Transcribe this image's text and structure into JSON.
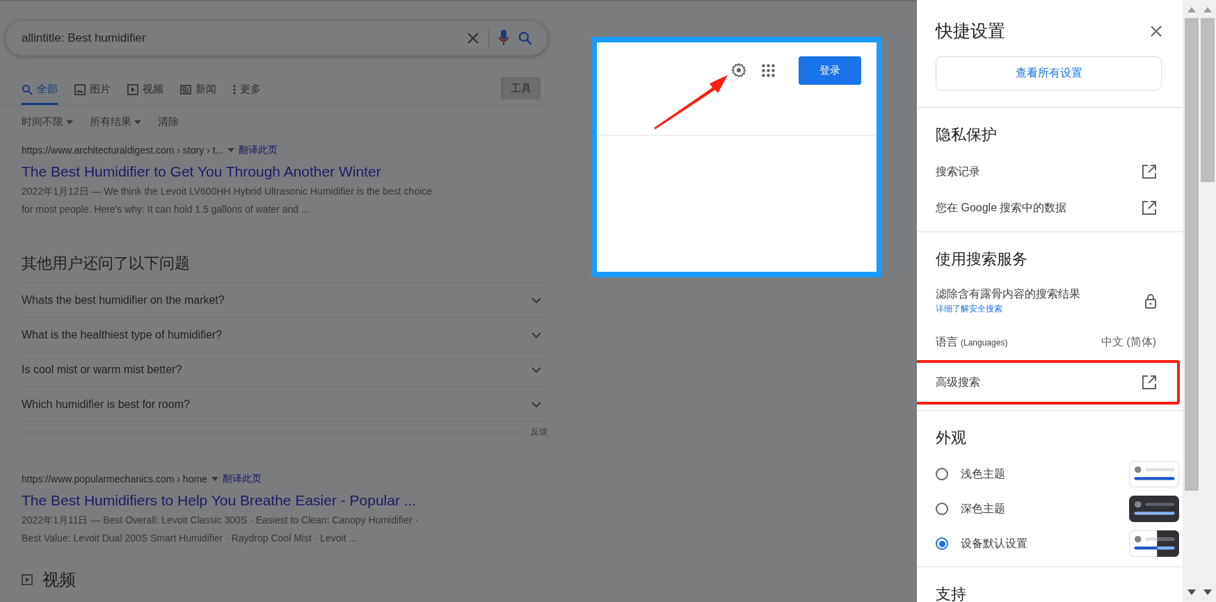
{
  "search": {
    "value": "allintitle: Best humidifier"
  },
  "tabs": [
    {
      "label": "全部",
      "kind": "all",
      "selected": true
    },
    {
      "label": "图片",
      "kind": "images",
      "selected": false
    },
    {
      "label": "视频",
      "kind": "videos",
      "selected": false
    },
    {
      "label": "新闻",
      "kind": "news",
      "selected": false
    },
    {
      "label": "更多",
      "kind": "more",
      "selected": false
    }
  ],
  "tools_button": "工具",
  "filters": [
    {
      "label": "时间不限",
      "dropdown": true
    },
    {
      "label": "所有结果",
      "dropdown": true
    },
    {
      "label": "清除",
      "dropdown": false
    }
  ],
  "results": [
    {
      "url": "https://www.architecturaldigest.com › story › t...",
      "translate": "翻译此页",
      "title": "The Best Humidifier to Get You Through Another Winter",
      "snippet": [
        "2022年1月12日 — We think the Levoit LV600HH Hybrid Ultrasonic Humidifier is the best choice",
        "for most people. Here's why: It can hold 1.5 gallons of water and ..."
      ]
    },
    {
      "url": "https://www.popularmechanics.com › home",
      "translate": "翻译此页",
      "title": "The Best Humidifiers to Help You Breathe Easier - Popular ...",
      "snippet": [
        "2022年1月11日 — Best Overall: Levoit Classic 300S · Easiest to Clean: Canopy Humidifier ·",
        "Best Value: Levoit Dual 200S Smart Humidifier · Raydrop Cool Mist · Levoit ..."
      ]
    }
  ],
  "questions": {
    "heading": "其他用户还问了以下问题",
    "items": [
      {
        "text": "Whats the best humidifier on the market?",
        "expanded": false
      },
      {
        "text": "What is the healthiest type of humidifier?",
        "expanded": false
      },
      {
        "text": "Is cool mist or warm mist better?",
        "expanded": false
      },
      {
        "text": "Which humidifier is best for room?",
        "expanded": false
      }
    ],
    "feedback": "反馈"
  },
  "videos_heading": "视频",
  "inset": {
    "sign_in": "登录"
  },
  "panel": {
    "title": "快捷设置",
    "view_all": "查看所有设置",
    "sections": [
      {
        "heading": "隐私保护",
        "items": [
          {
            "kind": "link",
            "label": "搜索记录",
            "highlighted": false
          },
          {
            "kind": "link",
            "label": "您在 Google 搜索中的数据",
            "highlighted": false
          }
        ]
      },
      {
        "heading": "使用搜索服务",
        "items": [
          {
            "kind": "safe",
            "label": "滤除含有露骨内容的搜索结果",
            "sublink": "详细了解安全搜索"
          },
          {
            "kind": "language",
            "label": "语言",
            "note": "(Languages)",
            "value": "中文 (简体)"
          },
          {
            "kind": "link",
            "label": "高级搜索",
            "highlighted": true
          }
        ]
      },
      {
        "heading": "外观",
        "items": [
          {
            "kind": "light_theme",
            "label": "浅色主题",
            "selected": false
          },
          {
            "kind": "dark_theme",
            "label": "深色主题",
            "selected": false
          },
          {
            "kind": "auto_theme",
            "label": "设备默认设置",
            "selected": true
          }
        ]
      },
      {
        "heading": "支持"
      }
    ]
  }
}
